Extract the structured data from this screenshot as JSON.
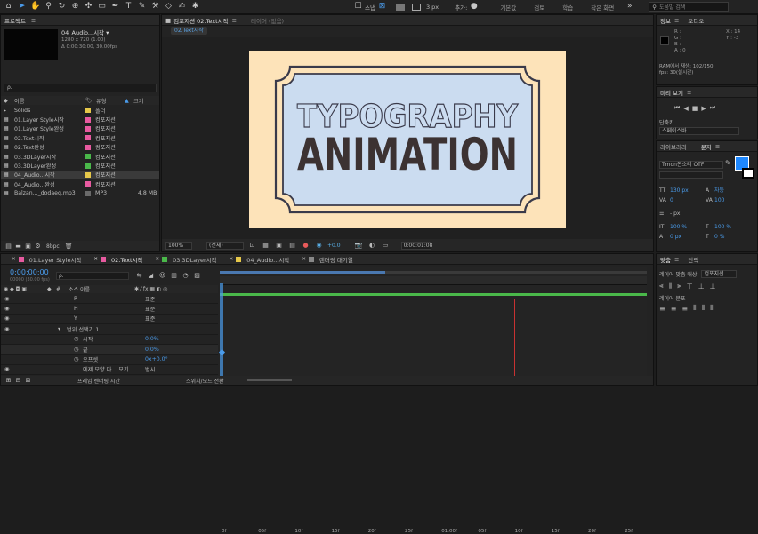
{
  "toolbar": {
    "snap_label": "스냅",
    "stroke_px": "3 px",
    "add_label": "추가:",
    "workspaces": [
      "기본값",
      "검토",
      "학습",
      "작은 화면"
    ],
    "search_placeholder": "도움말 검색"
  },
  "project": {
    "panel_title": "프로젝트",
    "selected_name": "04_Audio...시작 ▾",
    "selected_info1": "1280 x 720 (1.00)",
    "selected_info2": "Δ 0:00:30:00, 30.00fps",
    "search_placeholder": "ρ.",
    "col_name": "이름",
    "col_type": "유형",
    "col_size": "크기",
    "items": [
      {
        "name": "Solids",
        "type": "폴더",
        "size": "",
        "color": "#e6c84a"
      },
      {
        "name": "01.Layer Style시작",
        "type": "컴포지션",
        "size": "",
        "color": "#e85aa0"
      },
      {
        "name": "01.Layer Style완성",
        "type": "컴포지션",
        "size": "",
        "color": "#e85aa0"
      },
      {
        "name": "02.Text시작",
        "type": "컴포지션",
        "size": "",
        "color": "#e85aa0"
      },
      {
        "name": "02.Text완성",
        "type": "컴포지션",
        "size": "",
        "color": "#e85aa0"
      },
      {
        "name": "03.3DLayer시작",
        "type": "컴포지션",
        "size": "",
        "color": "#4ab84a"
      },
      {
        "name": "03.3DLayer완성",
        "type": "컴포지션",
        "size": "",
        "color": "#4ab84a"
      },
      {
        "name": "04_Audio...시작",
        "type": "컴포지션",
        "size": "",
        "color": "#e6c84a"
      },
      {
        "name": "04_Audio...완성",
        "type": "컴포지션",
        "size": "",
        "color": "#e85aa0"
      },
      {
        "name": "Balzan..._dodaeq.mp3",
        "type": "MP3",
        "size": "4.8 MB",
        "color": "#6a6a6a"
      }
    ],
    "bpc": "8bpc"
  },
  "composition": {
    "panel_title": "컴포지션 02.Text시작",
    "layer_tab": "레이어 (없음)",
    "comp_tab": "02.Text시작",
    "art_line1": "TYPOGRAPHY",
    "art_line2": "ANIMATION",
    "zoom": "100%",
    "resolution": "(전체)",
    "exposure": "+0.0",
    "timecode": "0:00:01:08",
    "colors": {
      "outer_bg": "#fde3b9",
      "card": "#cbdcf0",
      "stroke": "#3a3a4a",
      "text": "#3c3232"
    }
  },
  "info": {
    "tab": "정보",
    "tab2": "오디오",
    "r_label": "R :",
    "g_label": "G :",
    "b_label": "B :",
    "a_label": "A : 0",
    "x_label": "X : 14",
    "y_label": "Y : -3",
    "ram1": "RAM에서 재생: 102/150",
    "ram2": "fps: 30(실시간)"
  },
  "preview": {
    "title": "미리 보기"
  },
  "shortcuts": {
    "label": "단축키",
    "value": "스페이스바"
  },
  "character": {
    "tab1": "라이브러리",
    "tab2": "문자",
    "font": "Tmon몬소리 OTF",
    "size": "130 px",
    "leading": "자동",
    "kerning": "0",
    "tracking": "100",
    "stroke_width": "- px",
    "scale_v": "100 %",
    "scale_h": "100 %",
    "baseline": "0 px",
    "tsume": "0 %",
    "color": "#1e88ff"
  },
  "align": {
    "tab1": "맞춤",
    "tab2": "단락",
    "align_to_label": "레이어 맞춤 대상:",
    "align_to_value": "컴포지션",
    "distribute_label": "레이어 분포"
  },
  "timeline": {
    "tabs": [
      "01.Layer Style시작",
      "02.Text시작",
      "03.3DLayer시작",
      "04_Audio...시작",
      "렌더링 대기열"
    ],
    "tab_colors": [
      "#e85aa0",
      "#e85aa0",
      "#4ab84a",
      "#e6c84a",
      "#888888"
    ],
    "timecode": "0:00:00:00",
    "timecode_sub": "00000 (30.00 fps)",
    "search_placeholder": "ρ.",
    "source_name_header": "소스 이름",
    "parent_header": "부모 및 링크",
    "rows": [
      {
        "name": "P",
        "value": "표준"
      },
      {
        "name": "H",
        "value": "표준"
      },
      {
        "name": "Y",
        "value": "표준"
      },
      {
        "name": "범위 선택기 1",
        "value": ""
      },
      {
        "name": "시작",
        "value": "0.0%"
      },
      {
        "name": "끝",
        "value": "0.0%"
      },
      {
        "name": "오프셋",
        "value": "0x+0.0°"
      },
      {
        "name": "예제 모양 다... 모기",
        "value": "범시"
      }
    ],
    "ruler": [
      "0f",
      "05f",
      "10f",
      "15f",
      "20f",
      "25f",
      "01:00f",
      "05f",
      "10f",
      "15f",
      "20f",
      "25f"
    ],
    "footer_left": "프레임 렌더링 시간",
    "footer_right": "스위치/모드 전환"
  }
}
